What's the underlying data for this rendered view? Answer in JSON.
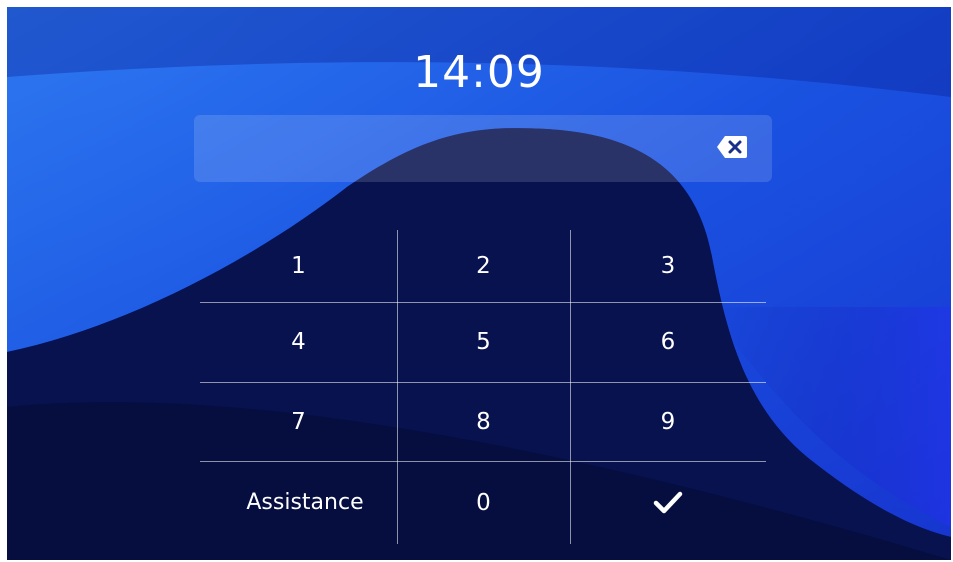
{
  "clock": {
    "time": "14:09"
  },
  "pin_entry": {
    "value": "",
    "backspace_icon": "backspace-icon"
  },
  "keypad": {
    "keys": [
      "1",
      "2",
      "3",
      "4",
      "5",
      "6",
      "7",
      "8",
      "9"
    ],
    "assistance_label": "Assistance",
    "zero_label": "0",
    "confirm_icon": "checkmark-icon"
  },
  "colors": {
    "background_dark": "#050d3a",
    "background_mid": "#0b1f9a",
    "wave_blue": "#1b55e6",
    "text": "#ffffff"
  }
}
